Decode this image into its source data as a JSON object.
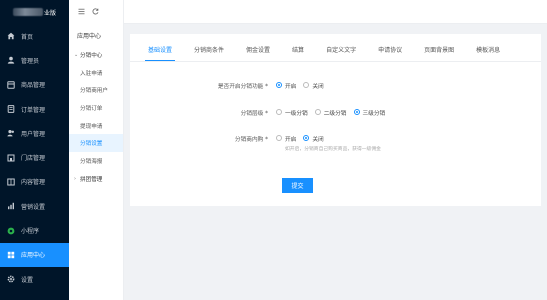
{
  "sidebar": {
    "brand_suffix": "业版",
    "items": [
      {
        "label": "首页",
        "icon": "home-icon",
        "active": false
      },
      {
        "label": "管理员",
        "icon": "user-admin-icon",
        "active": false
      },
      {
        "label": "商品管理",
        "icon": "goods-icon",
        "active": false
      },
      {
        "label": "订单管理",
        "icon": "order-icon",
        "active": false
      },
      {
        "label": "用户管理",
        "icon": "users-icon",
        "active": false
      },
      {
        "label": "门店管理",
        "icon": "store-icon",
        "active": false
      },
      {
        "label": "内容管理",
        "icon": "content-icon",
        "active": false
      },
      {
        "label": "营销设置",
        "icon": "marketing-icon",
        "active": false
      },
      {
        "label": "小程序",
        "icon": "miniapp-icon",
        "active": false
      },
      {
        "label": "应用中心",
        "icon": "app-center-icon",
        "active": true
      },
      {
        "label": "设置",
        "icon": "settings-icon",
        "active": false
      }
    ]
  },
  "subnav": {
    "title": "应用中心",
    "group_distribution": "分销中心",
    "items": [
      "入驻申请",
      "分销商用户",
      "分销订单",
      "提现申请",
      "分销设置",
      "分销海报"
    ],
    "active_item": "分销设置",
    "group_bargain": "拼团管理"
  },
  "tabs": [
    "基础设置",
    "分销商条件",
    "佣金设置",
    "结算",
    "自定义文字",
    "申请协议",
    "页面背景图",
    "模板消息"
  ],
  "form": {
    "enable": {
      "label": "是否开启分销功能",
      "options": [
        "开启",
        "关闭"
      ],
      "selected": "开启"
    },
    "level": {
      "label": "分销层级",
      "options": [
        "一级分销",
        "二级分销",
        "三级分销"
      ],
      "selected": "三级分销"
    },
    "self_buy": {
      "label": "分销商内购",
      "options": [
        "开启",
        "关闭"
      ],
      "selected": "关闭"
    },
    "self_buy_hint": "如开启，分销商自己购买商品，获得一级佣金",
    "submit": "提交"
  },
  "colors": {
    "sidebar_bg": "#001529",
    "accent": "#1890ff"
  }
}
